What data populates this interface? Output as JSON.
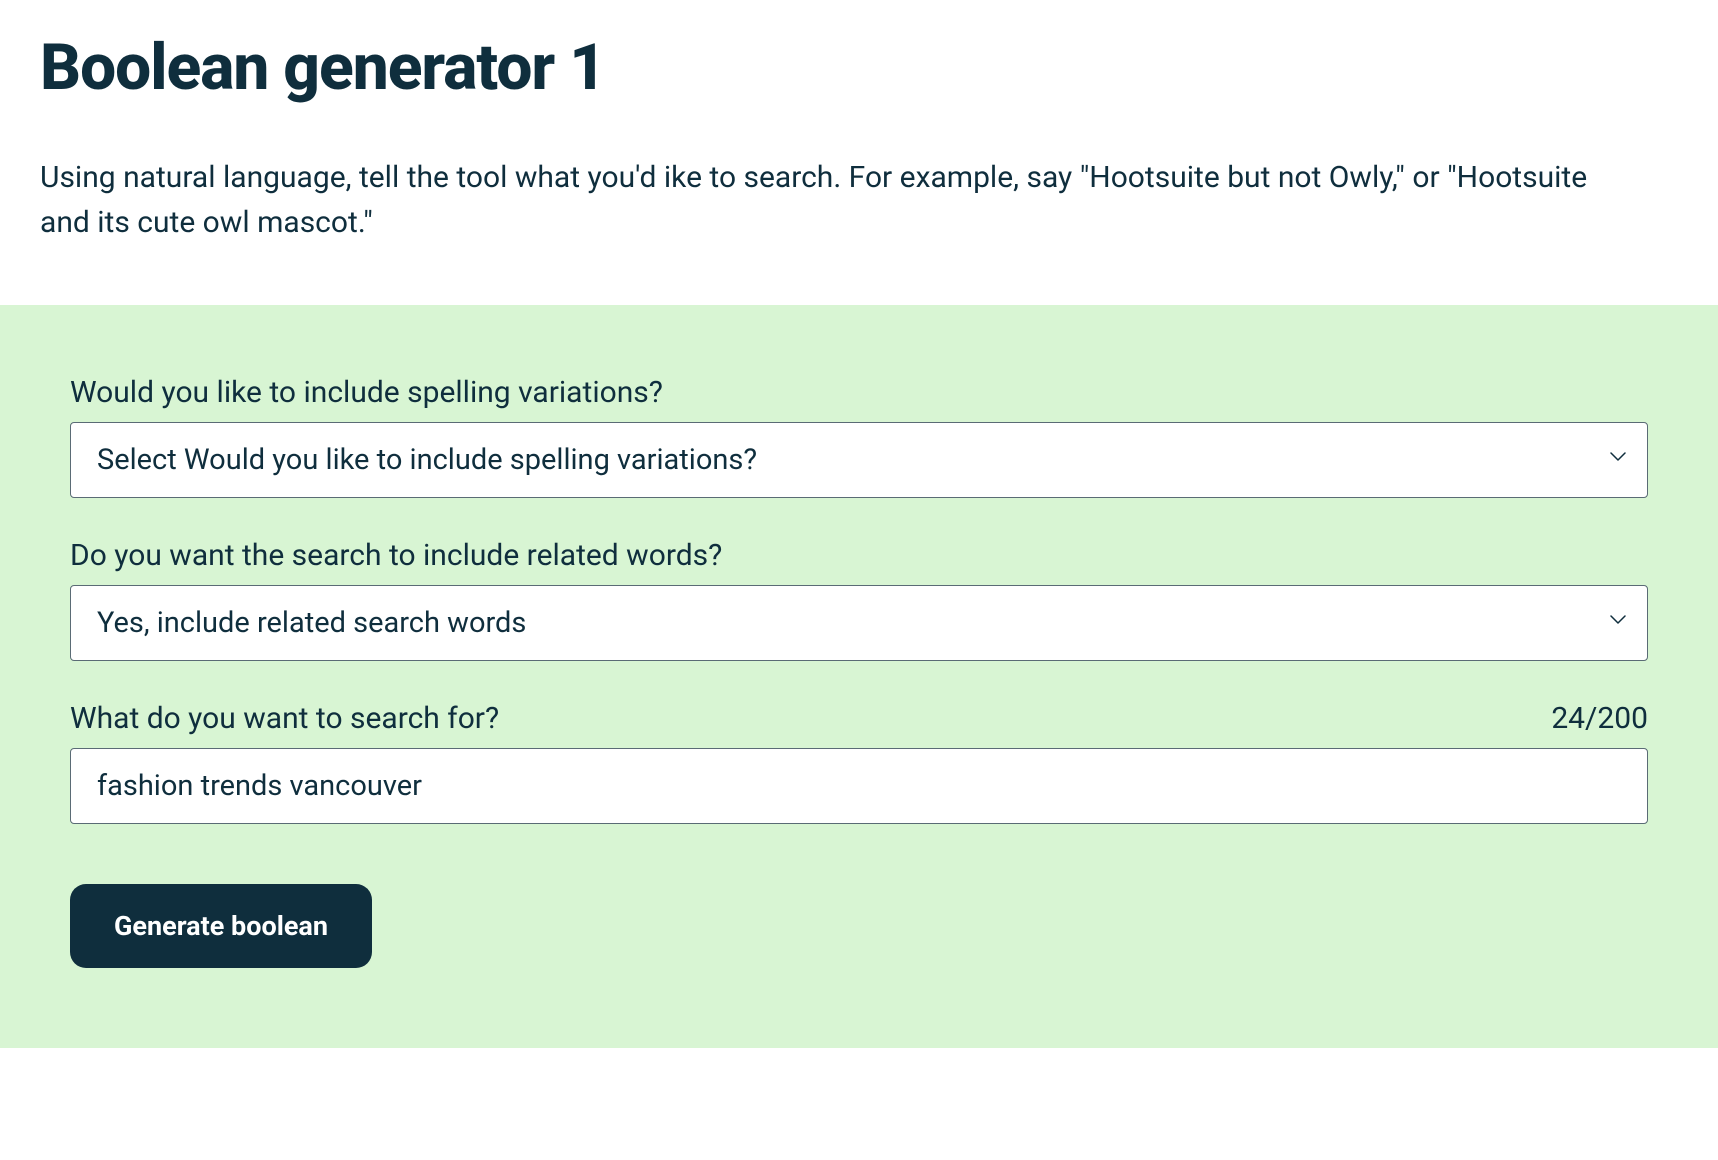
{
  "header": {
    "title": "Boolean generator 1",
    "description": "Using natural language, tell the tool what you'd ike to search. For example, say \"Hootsuite but not Owly,\" or \"Hootsuite and its cute owl mascot.\""
  },
  "form": {
    "spelling_variations": {
      "label": "Would you like to include spelling variations?",
      "selected": "Select Would you like to include spelling variations?"
    },
    "related_words": {
      "label": "Do you want the search to include related words?",
      "selected": "Yes, include related search words"
    },
    "search_query": {
      "label": "What do you want to search for?",
      "value": "fashion trends vancouver",
      "counter": "24/200"
    },
    "submit_label": "Generate boolean"
  }
}
